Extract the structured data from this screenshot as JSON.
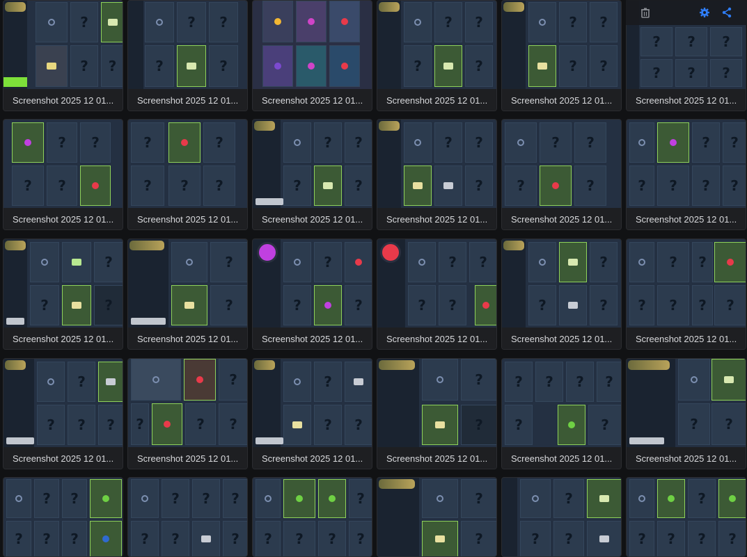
{
  "gallery": {
    "caption_text": "Screenshot 2025 12 01...",
    "rows": [
      {
        "row": 1,
        "items": [
          {
            "caption": "Screenshot 2025 12 01..."
          },
          {
            "caption": "Screenshot 2025 12 01..."
          },
          {
            "caption": "Screenshot 2025 12 01..."
          },
          {
            "caption": "Screenshot 2025 12 01..."
          },
          {
            "caption": "Screenshot 2025 12 01..."
          },
          {
            "caption": "Screenshot 2025 12 01..."
          }
        ]
      },
      {
        "row": 2,
        "items": [
          {
            "caption": "Screenshot 2025 12 01..."
          },
          {
            "caption": "Screenshot 2025 12 01..."
          },
          {
            "caption": "Screenshot 2025 12 01..."
          },
          {
            "caption": "Screenshot 2025 12 01..."
          },
          {
            "caption": "Screenshot 2025 12 01..."
          },
          {
            "caption": "Screenshot 2025 12 01..."
          }
        ]
      },
      {
        "row": 3,
        "items": [
          {
            "caption": "Screenshot 2025 12 01..."
          },
          {
            "caption": "Screenshot 2025 12 01..."
          },
          {
            "caption": "Screenshot 2025 12 01..."
          },
          {
            "caption": "Screenshot 2025 12 01..."
          },
          {
            "caption": "Screenshot 2025 12 01..."
          },
          {
            "caption": "Screenshot 2025 12 01..."
          }
        ]
      },
      {
        "row": 4,
        "items": [
          {
            "caption": "Screenshot 2025 12 01..."
          },
          {
            "caption": "Screenshot 2025 12 01..."
          },
          {
            "caption": "Screenshot 2025 12 01..."
          },
          {
            "caption": "Screenshot 2025 12 01..."
          },
          {
            "caption": "Screenshot 2025 12 01..."
          },
          {
            "caption": "Screenshot 2025 12 01..."
          }
        ]
      }
    ],
    "partial_row_thumbnails": 6
  },
  "toolbar": {
    "icons": [
      "trash-icon",
      "gear-icon",
      "share-icon"
    ],
    "colors": {
      "trash": "#8a8d93",
      "gear": "#2f7df6",
      "share": "#2f7df6"
    }
  },
  "colors": {
    "background": "#111214",
    "tile": "#1c1d20",
    "caption_text": "#d8d9dc",
    "thumb_bg": "#243042",
    "cell_bg": "#2c3b4e",
    "highlight_green": "#8fd25a"
  }
}
